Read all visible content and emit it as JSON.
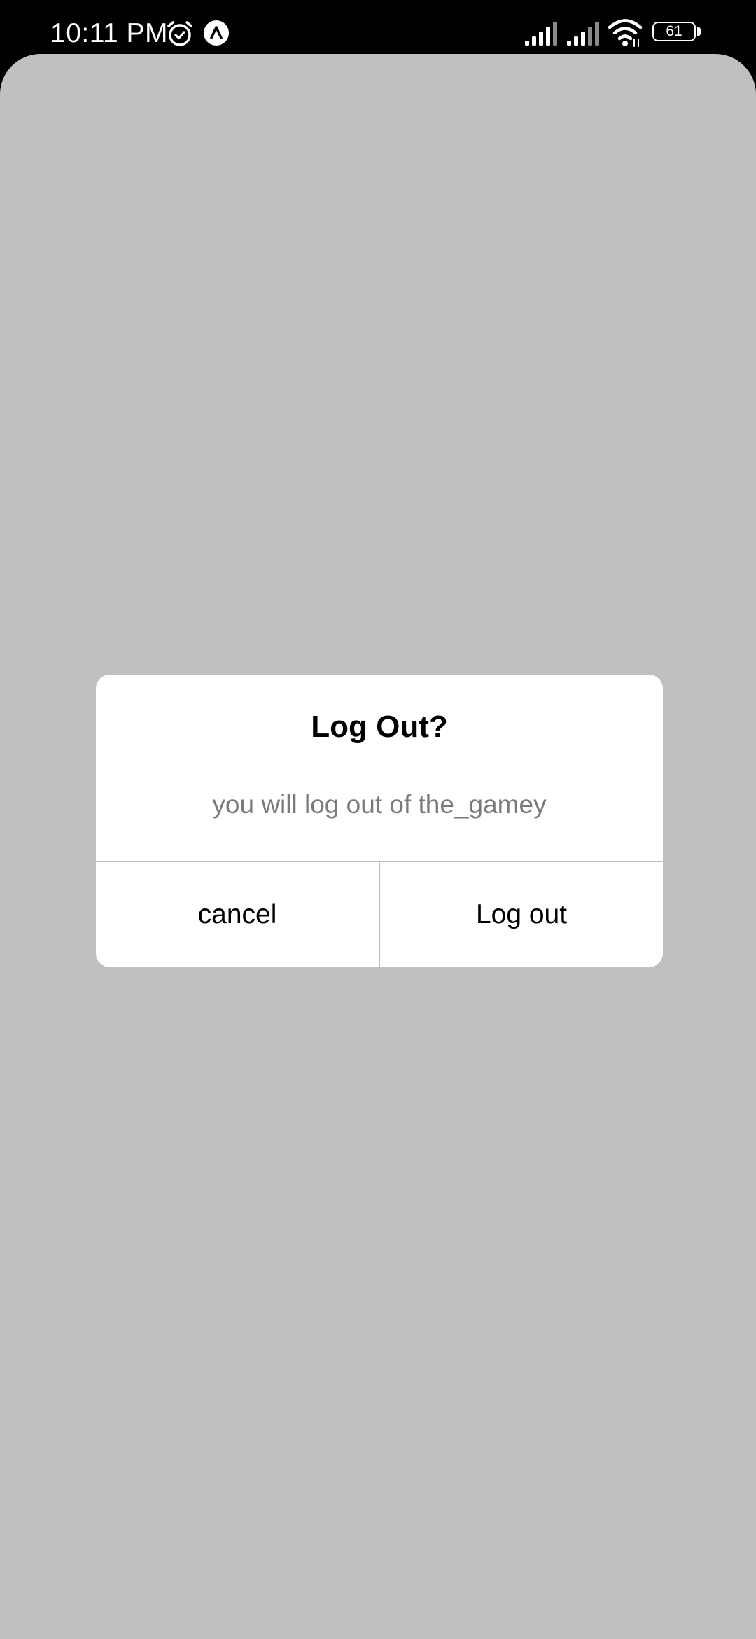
{
  "status_bar": {
    "time": "10:11 PM",
    "battery_level": "61",
    "icons": [
      "alarm-icon",
      "navigation-icon",
      "signal-icon",
      "signal-icon",
      "wifi-icon",
      "battery-icon"
    ]
  },
  "dialog": {
    "title": "Log Out?",
    "message": "you will log out of the_gamey",
    "cancel_label": "cancel",
    "confirm_label": "Log out"
  },
  "colors": {
    "backdrop": "#c0c0c0",
    "dialog_bg": "#ffffff",
    "message_text": "#7a7a7a",
    "divider": "#bdbdbd",
    "status_bar_bg": "#000000"
  }
}
